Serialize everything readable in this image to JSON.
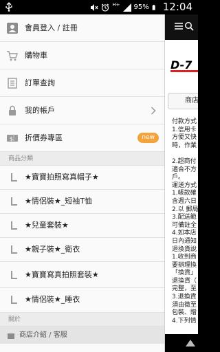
{
  "status": {
    "network": "H+",
    "battery": "95%",
    "time": "12:04"
  },
  "drawer": {
    "top_items": [
      {
        "label": "會員登入 / 註冊",
        "icon": "user-icon"
      },
      {
        "label": "購物車",
        "icon": "cart-icon"
      },
      {
        "label": "訂單查詢",
        "icon": "order-list-icon"
      },
      {
        "label": "我的帳戶",
        "icon": "lock-icon"
      },
      {
        "label": "折價券專區",
        "icon": "coupon-icon",
        "badge": "new"
      }
    ],
    "categories_header": "商品分類",
    "categories": [
      "★寶寶拍照寫真帽子★",
      "★情侶裝★_短袖T恤",
      "★兒童套裝★",
      "★親子裝★_衛衣",
      "★寶寶寫真拍照套裝★",
      "★情侶裝★_睡衣"
    ],
    "about_header": "關於",
    "about_item": "商店介紹 / 客服"
  },
  "content": {
    "logo_text": "D-7",
    "store_button": "商店",
    "info_lines": [
      "付款方式",
      "1.信用卡",
      "方便又快",
      "時，作業",
      "",
      "2.超商付",
      "適合不方",
      "戶。",
      "運送方式",
      "1.帳款確",
      "含週六日",
      "2.以 郵局",
      "3.配送範",
      "可備註全",
      "4.如本店",
      "日內通知",
      "退換貨說",
      "1.收到商",
      "要辦理換",
      "「換貨」",
      "退換貨（",
      "完整，至",
      "3.退換貨",
      "須由徵至",
      "包裝、贈",
      "4.下列情"
    ]
  },
  "colors": {
    "badge": "#f4a23a",
    "logo_red": "#d42424"
  }
}
